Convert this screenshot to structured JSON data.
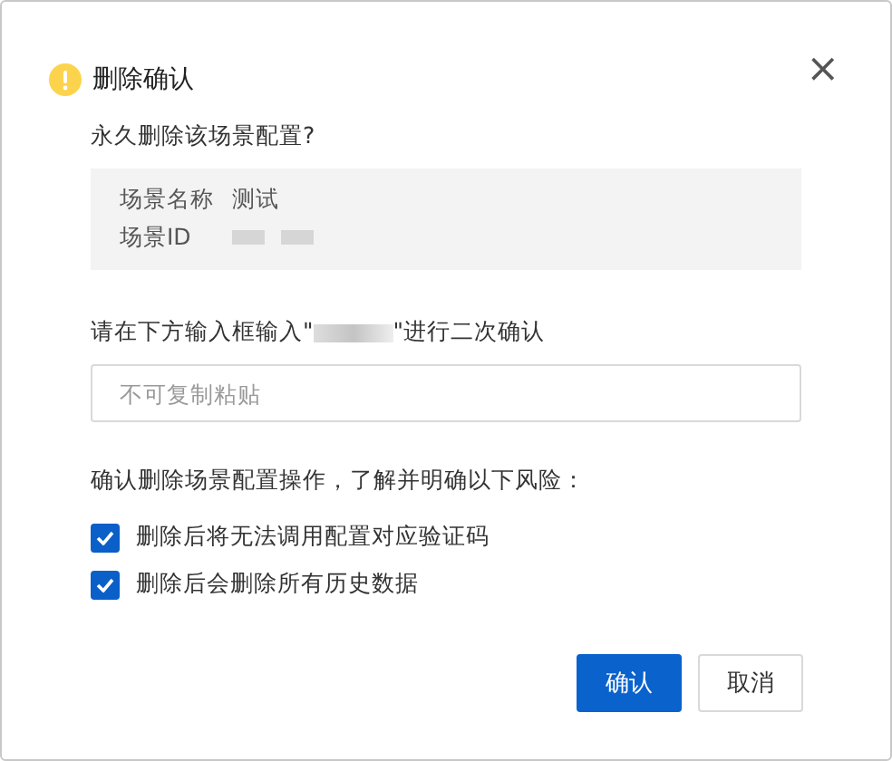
{
  "dialog": {
    "title": "删除确认",
    "close": "×"
  },
  "question": "永久删除该场景配置?",
  "scene_info": [
    {
      "label": "场景名称",
      "value": "测试",
      "redacted": false
    },
    {
      "label": "场景ID",
      "redacted": true
    }
  ],
  "instruction": {
    "before": "请在下方输入框输入\"",
    "after": "\"进行二次确认",
    "redacted": true
  },
  "input": {
    "placeholder": "不可复制粘贴"
  },
  "risk_prompt": "确认删除场景配置操作，了解并明确以下风险：",
  "risks": [
    {
      "label": "删除后将无法调用配置对应验证码",
      "checked": true
    },
    {
      "label": "删除后会删除所有历史数据",
      "checked": true
    }
  ],
  "buttons": [
    {
      "label": "确认",
      "kind": "primary"
    },
    {
      "label": "取消",
      "kind": "default"
    }
  ]
}
